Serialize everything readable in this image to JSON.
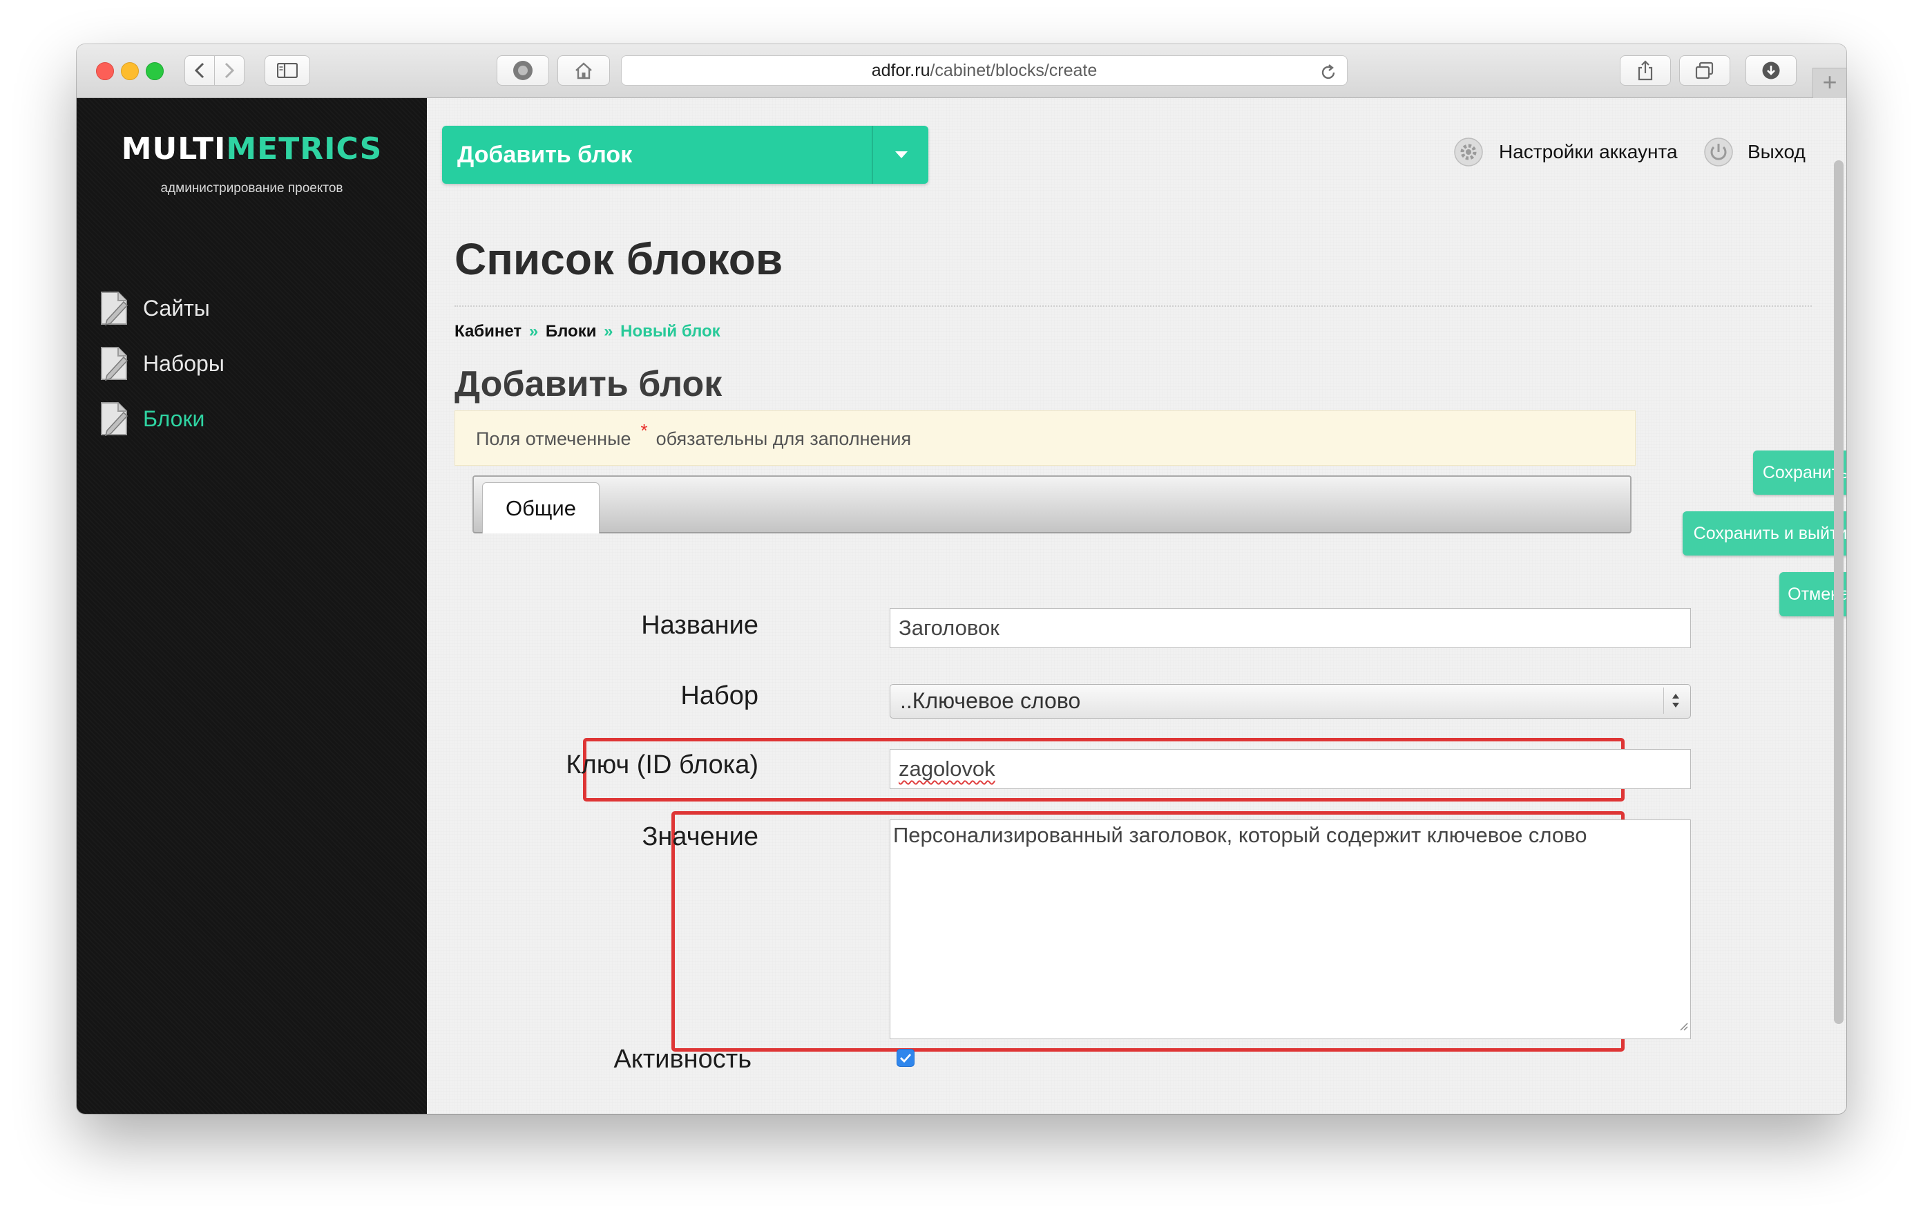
{
  "browser": {
    "url_host": "adfor.ru",
    "url_path": "/cabinet/blocks/create",
    "new_tab": "+"
  },
  "sidebar": {
    "logo_white": "MULTI",
    "logo_accent": "METRICS",
    "logo_subtitle": "администрирование проектов",
    "items": [
      {
        "label": "Сайты",
        "icon": "document-icon",
        "active": false
      },
      {
        "label": "Наборы",
        "icon": "document-icon",
        "active": false
      },
      {
        "label": "Блоки",
        "icon": "document-icon",
        "active": true
      }
    ]
  },
  "header": {
    "add_dropdown_label": "Добавить блок",
    "account_settings": "Настройки аккаунта",
    "logout": "Выход"
  },
  "page": {
    "title": "Список блоков",
    "breadcrumb": [
      {
        "label": "Кабинет"
      },
      {
        "sep": "»"
      },
      {
        "label": "Блоки"
      },
      {
        "sep": "»"
      },
      {
        "label": "Новый блок"
      }
    ],
    "section_title": "Добавить блок",
    "notice_before": "Поля отмеченные",
    "notice_star": "*",
    "notice_after": "обязательны для заполнения",
    "tab_general": "Общие"
  },
  "actions": {
    "save": "Сохранить",
    "save_exit": "Сохранить и выйти",
    "cancel": "Отмена"
  },
  "form": {
    "name_label": "Название",
    "name_value": "Заголовок",
    "set_label": "Набор",
    "set_value": "..Ключевое слово",
    "key_label": "Ключ (ID блока)",
    "key_value": "zagolovok",
    "value_label": "Значение",
    "value_text": "Персонализированный заголовок, который содержит ключевое слово",
    "active_label": "Активность",
    "active_checked": true
  },
  "colors": {
    "accent": "#2fd4a2",
    "button": "#41d0a5",
    "highlight": "#de3535",
    "sidebar_bg": "#151515"
  }
}
